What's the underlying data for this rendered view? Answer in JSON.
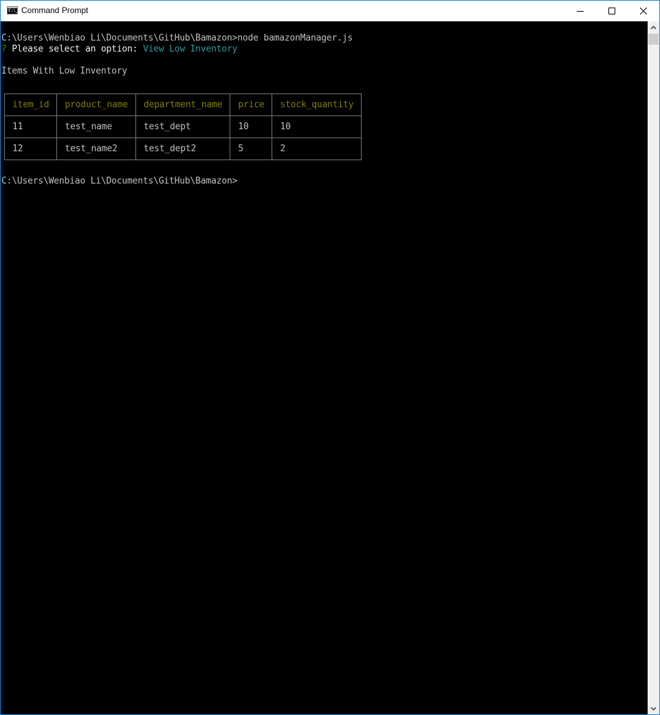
{
  "window": {
    "title": "Command Prompt",
    "icon": "cmd-icon",
    "icon_text": "C:\\_",
    "controls": [
      "minimize-icon",
      "maximize-icon",
      "close-icon"
    ]
  },
  "console": {
    "line1": "C:\\Users\\Wenbiao Li\\Documents\\GitHub\\Bamazon>node bamazonManager.js",
    "prompt_mark": "?",
    "prompt_text": " Please select an option: ",
    "prompt_answer": "View Low Inventory",
    "heading": "Items With Low Inventory",
    "final_prompt": "C:\\Users\\Wenbiao Li\\Documents\\GitHub\\Bamazon>"
  },
  "table": {
    "headers": [
      "item_id",
      "product_name",
      "department_name",
      "price",
      "stock_quantity"
    ],
    "rows": [
      [
        "11",
        "test_name",
        "test_dept",
        "10",
        "10"
      ],
      [
        "12",
        "test_name2",
        "test_dept2",
        "5",
        "2"
      ]
    ]
  },
  "colors": {
    "border_accent": "#1883d7",
    "console_bg": "#000000",
    "text_default": "#c0c0c0",
    "prompt_mark": "#13a10e",
    "answer": "#2b9a9a",
    "table_header": "#808000"
  }
}
